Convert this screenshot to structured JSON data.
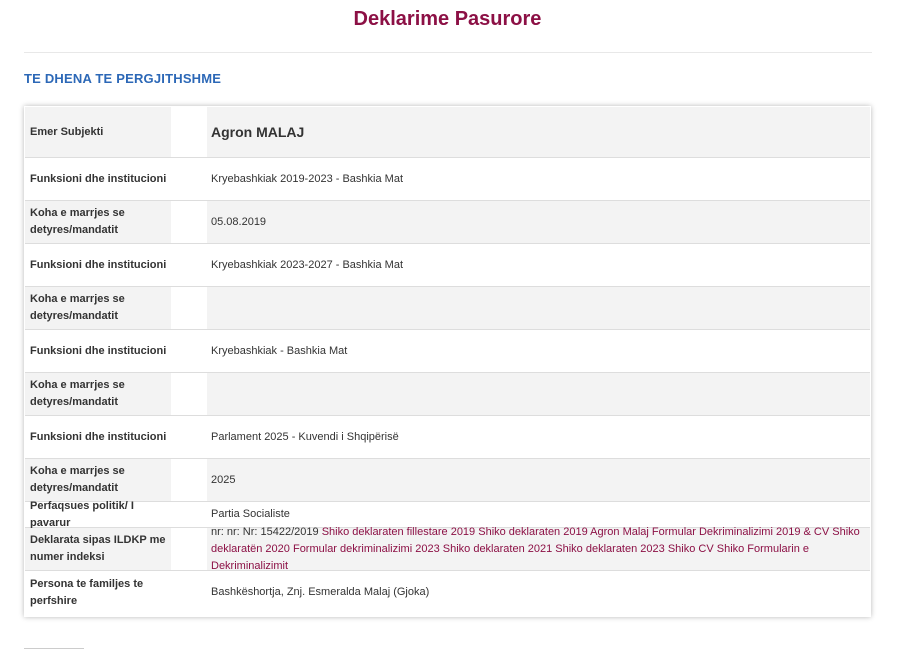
{
  "page": {
    "title": "Deklarime Pasurore",
    "section_heading": "TE DHENA TE PERGJITHSHME"
  },
  "rows": [
    {
      "label": "Emer Subjekti",
      "value": "Agron MALAJ"
    },
    {
      "label": "Funksioni dhe institucioni",
      "value": "Kryebashkiak 2019-2023 - Bashkia Mat"
    },
    {
      "label": "Koha e marrjes se detyres/mandatit",
      "value": "05.08.2019"
    },
    {
      "label": "Funksioni dhe institucioni",
      "value": "Kryebashkiak 2023-2027 - Bashkia Mat"
    },
    {
      "label": "Koha e marrjes se detyres/mandatit",
      "value": ""
    },
    {
      "label": "Funksioni dhe institucioni",
      "value": "Kryebashkiak - Bashkia Mat"
    },
    {
      "label": "Koha e marrjes se detyres/mandatit",
      "value": ""
    },
    {
      "label": "Funksioni dhe institucioni",
      "value": "Parlament 2025 - Kuvendi i Shqipërisë"
    },
    {
      "label": "Koha e marrjes se detyres/mandatit",
      "value": "2025"
    },
    {
      "label": "Perfaqsues politik/ I pavarur",
      "value": "Partia Socialiste"
    },
    {
      "label": "Deklarata sipas ILDKP me numer indeksi",
      "value": ""
    },
    {
      "label": "Persona te familjes te perfshire",
      "value": "Bashkëshortja, Znj. Esmeralda Malaj (Gjoka)"
    }
  ],
  "declaration": {
    "prefix": "nr: nr: Nr: 15422/2019",
    "links": [
      "Shiko deklaraten fillestare 2019",
      "Shiko deklaraten 2019",
      "Agron Malaj Formular Dekriminalizimi 2019 & CV",
      "Shiko deklaratën 2020",
      "Formular dekriminalizimi 2023",
      "Shiko deklaraten 2021",
      "Shiko deklaraten 2023",
      "Shiko CV",
      "Shiko Formularin e Dekriminalizimit"
    ]
  },
  "colors": {
    "title": "#8c1045",
    "heading": "#2c68b7",
    "link": "#8c1045",
    "row_odd": "#f3f3f3"
  }
}
